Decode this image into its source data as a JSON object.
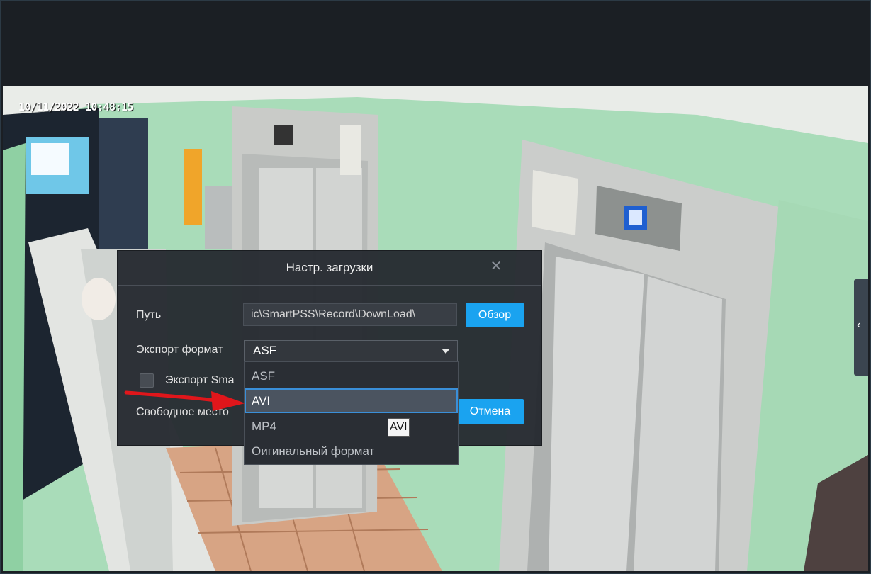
{
  "video": {
    "timestamp": "10/11/2022 10:48:15"
  },
  "dialog": {
    "title": "Настр. загрузки",
    "path_label": "Путь",
    "path_value": "ic\\SmartPSS\\Record\\DownLoad\\",
    "browse_label": "Обзор",
    "format_label": "Экспорт формат",
    "format_selected": "ASF",
    "export_checkbox_label": "Экспорт Sma",
    "free_space_label": "Свободное место",
    "cancel_label": "Отмена"
  },
  "dropdown": {
    "options": [
      "ASF",
      "AVI",
      "MP4",
      "Оигинальный формат"
    ],
    "highlighted": "AVI",
    "tooltip": "AVI"
  },
  "colors": {
    "accent": "#1aa3f0",
    "dialog_bg": "#24282e",
    "annotation_arrow": "#e0161b"
  }
}
